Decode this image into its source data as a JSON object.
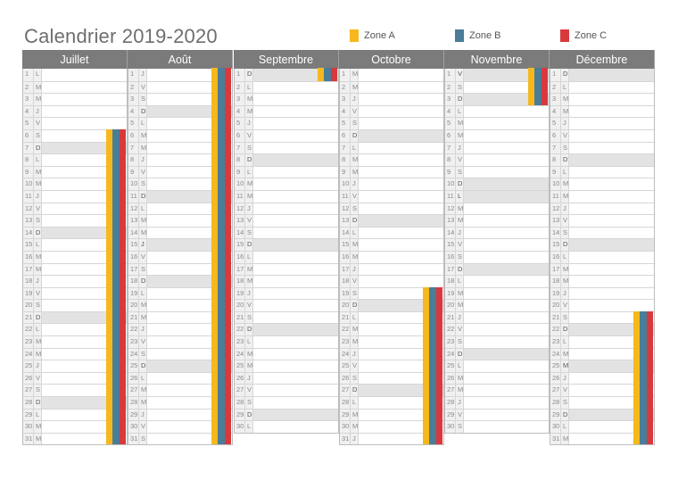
{
  "title": "Calendrier 2019-2020",
  "legend": [
    {
      "label": "Zone A",
      "color": "#f6b81c"
    },
    {
      "label": "Zone B",
      "color": "#4a7d97"
    },
    {
      "label": "Zone C",
      "color": "#d8393d"
    }
  ],
  "months": [
    {
      "name": "Juillet",
      "days": [
        "L",
        "M",
        "M",
        "J",
        "V",
        "S",
        "D",
        "L",
        "M",
        "M",
        "J",
        "V",
        "S",
        "D",
        "L",
        "M",
        "M",
        "J",
        "V",
        "S",
        "D",
        "L",
        "M",
        "M",
        "J",
        "V",
        "S",
        "D",
        "L",
        "M",
        "M"
      ],
      "shaded": [
        7,
        14,
        21,
        28
      ],
      "holidays_all_zones": [
        6,
        7,
        8,
        9,
        10,
        11,
        12,
        13,
        14,
        15,
        16,
        17,
        18,
        19,
        20,
        21,
        22,
        23,
        24,
        25,
        26,
        27,
        28,
        29,
        30,
        31
      ]
    },
    {
      "name": "Août",
      "days": [
        "J",
        "V",
        "S",
        "D",
        "L",
        "M",
        "M",
        "J",
        "V",
        "S",
        "D",
        "L",
        "M",
        "M",
        "J",
        "V",
        "S",
        "D",
        "L",
        "M",
        "M",
        "J",
        "V",
        "S",
        "D",
        "L",
        "M",
        "M",
        "J",
        "V",
        "S"
      ],
      "shaded": [
        4,
        11,
        15,
        18,
        25
      ],
      "holidays_all_zones": [
        1,
        2,
        3,
        4,
        5,
        6,
        7,
        8,
        9,
        10,
        11,
        12,
        13,
        14,
        15,
        16,
        17,
        18,
        19,
        20,
        21,
        22,
        23,
        24,
        25,
        26,
        27,
        28,
        29,
        30,
        31
      ]
    },
    {
      "name": "Septembre",
      "days": [
        "D",
        "L",
        "M",
        "M",
        "J",
        "V",
        "S",
        "D",
        "L",
        "M",
        "M",
        "J",
        "V",
        "S",
        "D",
        "L",
        "M",
        "M",
        "J",
        "V",
        "S",
        "D",
        "L",
        "M",
        "M",
        "J",
        "V",
        "S",
        "D",
        "L"
      ],
      "shaded": [
        1,
        8,
        15,
        22,
        29
      ],
      "holidays_all_zones": [
        1
      ]
    },
    {
      "name": "Octobre",
      "days": [
        "M",
        "M",
        "J",
        "V",
        "S",
        "D",
        "L",
        "M",
        "M",
        "J",
        "V",
        "S",
        "D",
        "L",
        "M",
        "M",
        "J",
        "V",
        "S",
        "D",
        "L",
        "M",
        "M",
        "J",
        "V",
        "S",
        "D",
        "L",
        "M",
        "M",
        "J"
      ],
      "shaded": [
        6,
        13,
        20,
        27
      ],
      "holidays_all_zones": [
        19,
        20,
        21,
        22,
        23,
        24,
        25,
        26,
        27,
        28,
        29,
        30,
        31
      ]
    },
    {
      "name": "Novembre",
      "days": [
        "V",
        "S",
        "D",
        "L",
        "M",
        "M",
        "J",
        "V",
        "S",
        "D",
        "L",
        "M",
        "M",
        "J",
        "V",
        "S",
        "D",
        "L",
        "M",
        "M",
        "J",
        "V",
        "S",
        "D",
        "L",
        "M",
        "M",
        "J",
        "V",
        "S"
      ],
      "shaded": [
        1,
        3,
        10,
        11,
        17,
        24
      ],
      "holidays_all_zones": [
        1,
        2,
        3
      ]
    },
    {
      "name": "Décembre",
      "days": [
        "D",
        "L",
        "M",
        "M",
        "J",
        "V",
        "S",
        "D",
        "L",
        "M",
        "M",
        "J",
        "V",
        "S",
        "D",
        "L",
        "M",
        "M",
        "J",
        "V",
        "S",
        "D",
        "L",
        "M",
        "M",
        "J",
        "V",
        "S",
        "D",
        "L",
        "M"
      ],
      "shaded": [
        1,
        8,
        15,
        22,
        25,
        29
      ],
      "holidays_all_zones": [
        21,
        22,
        23,
        24,
        25,
        26,
        27,
        28,
        29,
        30,
        31
      ]
    }
  ]
}
